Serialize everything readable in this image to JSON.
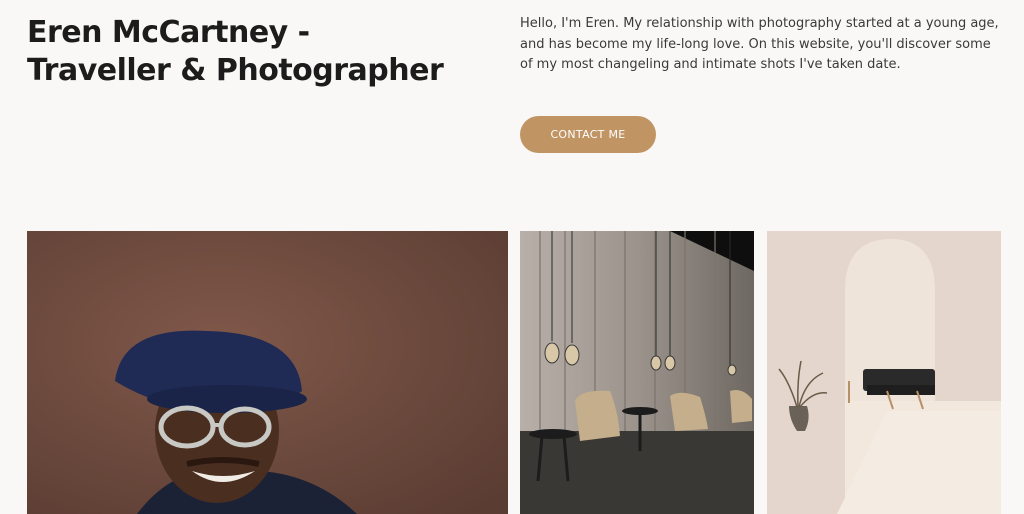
{
  "header": {
    "title": "Eren McCartney - Traveller & Photographer",
    "intro": "Hello, I'm Eren. My relationship with photography started at a young age, and has become my life-long love. On this website, you'll discover some of my most changeling and intimate shots I've taken date.",
    "contact_label": "CONTACT ME"
  },
  "colors": {
    "background": "#faf8f6",
    "accent": "#c19463",
    "text": "#1c1c1c"
  },
  "gallery": [
    {
      "name": "portrait-photo",
      "subject": "smiling man in navy beret and glasses"
    },
    {
      "name": "lounge-photo",
      "subject": "lounge chairs with pendant lamps and curtains"
    },
    {
      "name": "arch-room-photo",
      "subject": "minimal room with arched doorway and sofa"
    }
  ]
}
